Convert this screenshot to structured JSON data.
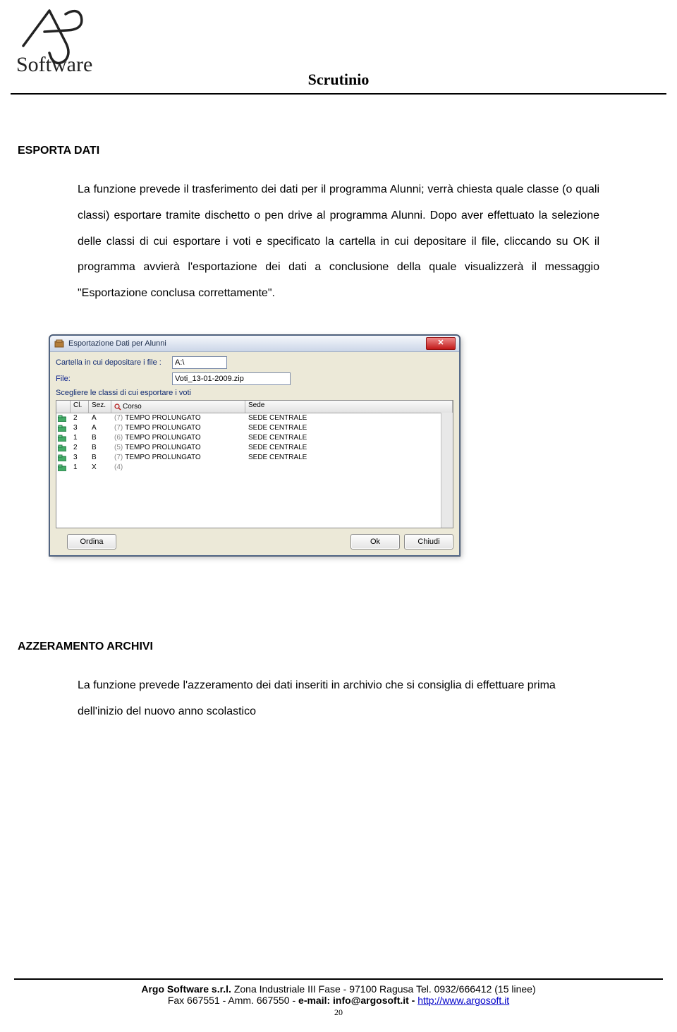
{
  "page_title": "Scrutinio",
  "logo_text": "Software",
  "section1": {
    "label": "ESPORTA DATI",
    "p1": "La funzione prevede il trasferimento dei dati per il programma Alunni; verrà chiesta quale classe (o quali classi) esportare tramite dischetto o pen drive al programma Alunni. Dopo aver effettuato la selezione  delle classi di cui esportare i voti e specificato la cartella in cui depositare il file, cliccando su OK il programma avvierà l'esportazione dei dati a conclusione della quale visualizzerà il messaggio \"Esportazione conclusa correttamente\"."
  },
  "dialog": {
    "title": "Esportazione Dati per Alunni",
    "path_label": "Cartella in cui depositare i file :",
    "path_value": "A:\\",
    "file_label": "File:",
    "file_value": "Voti_13-01-2009.zip",
    "subhead": "Scegliere le classi di cui esportare i voti",
    "columns": {
      "cl": "Cl.",
      "sez": "Sez.",
      "corso": "Corso",
      "sede": "Sede"
    },
    "rows": [
      {
        "cl": "2",
        "sez": "A",
        "paren": "(7)",
        "corso": "TEMPO PROLUNGATO",
        "sede": "SEDE CENTRALE"
      },
      {
        "cl": "3",
        "sez": "A",
        "paren": "(7)",
        "corso": "TEMPO PROLUNGATO",
        "sede": "SEDE CENTRALE"
      },
      {
        "cl": "1",
        "sez": "B",
        "paren": "(6)",
        "corso": "TEMPO PROLUNGATO",
        "sede": "SEDE CENTRALE"
      },
      {
        "cl": "2",
        "sez": "B",
        "paren": "(5)",
        "corso": "TEMPO PROLUNGATO",
        "sede": "SEDE CENTRALE"
      },
      {
        "cl": "3",
        "sez": "B",
        "paren": "(7)",
        "corso": "TEMPO PROLUNGATO",
        "sede": "SEDE CENTRALE"
      },
      {
        "cl": "1",
        "sez": "X",
        "paren": "(4)",
        "corso": "",
        "sede": ""
      }
    ],
    "btn_ordina": "Ordina",
    "btn_ok": "Ok",
    "btn_chiudi": "Chiudi"
  },
  "section2": {
    "label": "AZZERAMENTO ARCHIVI",
    "p1": "La funzione prevede l'azzeramento dei dati inseriti in archivio che si consiglia di effettuare prima dell'inizio del nuovo anno scolastico"
  },
  "footer": {
    "company": "Argo Software s.r.l.",
    "line1_rest": " Zona Industriale III Fase - 97100 Ragusa Tel. 0932/666412 (15 linee)",
    "line2_a": "Fax 667551 - Amm. 667550 - ",
    "line2_b": "e-mail: info@argosoft.it - ",
    "link": "http://www.argosoft.it",
    "page_number": "20"
  }
}
